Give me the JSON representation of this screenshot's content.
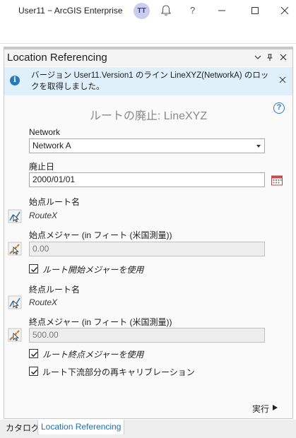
{
  "titlebar": {
    "user": "User11 − ArcGIS Enterprise",
    "avatar_initials": "TT",
    "help": "?"
  },
  "pane": {
    "title": "Location Referencing"
  },
  "info": {
    "message": "バージョン User11.Version1 のライン LineXYZ(NetworkA) のロックを取得しました。"
  },
  "tool": {
    "title": "ルートの廃止: LineXYZ",
    "help": "?"
  },
  "form": {
    "network_label": "Network",
    "network_value": "Network A",
    "retire_date_label": "廃止日",
    "retire_date_value": "2000/01/01",
    "from_route_label": "始点ルート名",
    "from_route_value": "RouteX",
    "from_measure_label": "始点メジャー (in フィート (米国測量))",
    "from_measure_value": "0.00",
    "use_route_start_label": "ルート開始メジャーを使用",
    "use_route_start_checked": true,
    "to_route_label": "終点ルート名",
    "to_route_value": "RouteX",
    "to_measure_label": "終点メジャー (in フィート (米国測量))",
    "to_measure_value": "500.00",
    "use_route_end_label": "ルート終点メジャーを使用",
    "use_route_end_checked": true,
    "recalibrate_label": "ルート下流部分の再キャリブレーション",
    "recalibrate_checked": true
  },
  "run_label": "実行",
  "tabs": [
    {
      "label": "カタログ",
      "active": false
    },
    {
      "label": "Location Referencing",
      "active": true
    }
  ],
  "colors": {
    "accent": "#2a7ab9",
    "info_bg": "#dff0fb",
    "active_tab_text": "#1a6fb3",
    "avatar_bg": "#c9cdf0"
  }
}
